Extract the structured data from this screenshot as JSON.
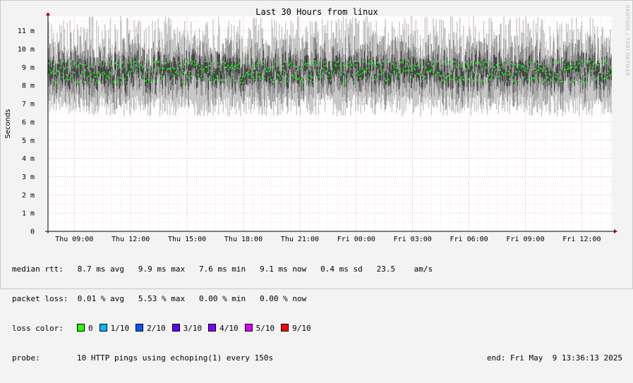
{
  "chart_data": {
    "type": "line",
    "title": "Last 30 Hours from linux",
    "ylabel": "Seconds",
    "xlabel": "",
    "ylim": [
      0,
      0.0118
    ],
    "yticks": [
      {
        "value": 0,
        "label": "0"
      },
      {
        "value": 0.001,
        "label": "1 m"
      },
      {
        "value": 0.002,
        "label": "2 m"
      },
      {
        "value": 0.003,
        "label": "3 m"
      },
      {
        "value": 0.004,
        "label": "4 m"
      },
      {
        "value": 0.005,
        "label": "5 m"
      },
      {
        "value": 0.006,
        "label": "6 m"
      },
      {
        "value": 0.007,
        "label": "7 m"
      },
      {
        "value": 0.008,
        "label": "8 m"
      },
      {
        "value": 0.009,
        "label": "9 m"
      },
      {
        "value": 0.01,
        "label": "10 m"
      },
      {
        "value": 0.011,
        "label": "11 m"
      }
    ],
    "xrange": [
      "2025-05-08 07:36",
      "2025-05-09 13:36"
    ],
    "xticks": [
      {
        "time": "2025-05-08 09:00",
        "label": "Thu 09:00"
      },
      {
        "time": "2025-05-08 12:00",
        "label": "Thu 12:00"
      },
      {
        "time": "2025-05-08 15:00",
        "label": "Thu 15:00"
      },
      {
        "time": "2025-05-08 18:00",
        "label": "Thu 18:00"
      },
      {
        "time": "2025-05-08 21:00",
        "label": "Thu 21:00"
      },
      {
        "time": "2025-05-09 00:00",
        "label": "Fri 00:00"
      },
      {
        "time": "2025-05-09 03:00",
        "label": "Fri 03:00"
      },
      {
        "time": "2025-05-09 06:00",
        "label": "Fri 06:00"
      },
      {
        "time": "2025-05-09 09:00",
        "label": "Fri 09:00"
      },
      {
        "time": "2025-05-09 12:00",
        "label": "Fri 12:00"
      }
    ],
    "grid": true,
    "series": [
      {
        "name": "median rtt",
        "color": "#00ff00",
        "summary": {
          "avg": 0.0087,
          "max": 0.0099,
          "min": 0.0076,
          "now": 0.0091,
          "sd": 0.0004
        },
        "smoke_band_typical": [
          0.0068,
          0.0103
        ],
        "smoke_band_extreme": [
          0.0063,
          0.0118
        ]
      }
    ],
    "watermark": "RRDTOOL / TOBI OETIKER"
  },
  "legend": {
    "median_rtt": {
      "label": "median rtt:",
      "avg": "8.7 ms avg",
      "max": "9.9 ms max",
      "min": "7.6 ms min",
      "now": "9.1 ms now",
      "sd": "0.4 ms sd",
      "amps": "23.5    am/s"
    },
    "packet_loss": {
      "label": "packet loss:",
      "avg": "0.01 % avg",
      "max": "5.53 % max",
      "min": "0.00 % min",
      "now": "0.00 % now"
    },
    "loss_color": {
      "label": "loss color:",
      "items": [
        {
          "label": "0",
          "color": "#26ff00"
        },
        {
          "label": "1/10",
          "color": "#00b8ff"
        },
        {
          "label": "2/10",
          "color": "#0059ff"
        },
        {
          "label": "3/10",
          "color": "#5e00ff"
        },
        {
          "label": "4/10",
          "color": "#7e00ff"
        },
        {
          "label": "5/10",
          "color": "#dd00ff"
        },
        {
          "label": "9/10",
          "color": "#ff0000"
        }
      ]
    },
    "probe": {
      "label": "probe:",
      "text": "10 HTTP pings using echoping(1) every 150s"
    },
    "end": "end: Fri May  9 13:36:13 2025"
  }
}
